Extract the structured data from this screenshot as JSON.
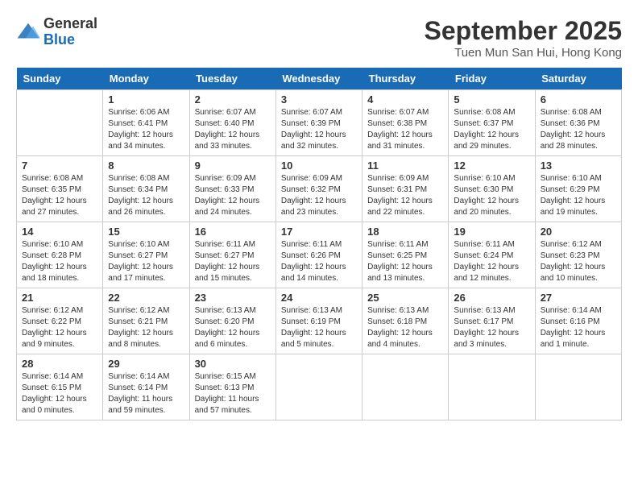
{
  "header": {
    "logo_general": "General",
    "logo_blue": "Blue",
    "month_title": "September 2025",
    "location": "Tuen Mun San Hui, Hong Kong"
  },
  "days_of_week": [
    "Sunday",
    "Monday",
    "Tuesday",
    "Wednesday",
    "Thursday",
    "Friday",
    "Saturday"
  ],
  "weeks": [
    [
      {
        "day": "",
        "detail": ""
      },
      {
        "day": "1",
        "detail": "Sunrise: 6:06 AM\nSunset: 6:41 PM\nDaylight: 12 hours\nand 34 minutes."
      },
      {
        "day": "2",
        "detail": "Sunrise: 6:07 AM\nSunset: 6:40 PM\nDaylight: 12 hours\nand 33 minutes."
      },
      {
        "day": "3",
        "detail": "Sunrise: 6:07 AM\nSunset: 6:39 PM\nDaylight: 12 hours\nand 32 minutes."
      },
      {
        "day": "4",
        "detail": "Sunrise: 6:07 AM\nSunset: 6:38 PM\nDaylight: 12 hours\nand 31 minutes."
      },
      {
        "day": "5",
        "detail": "Sunrise: 6:08 AM\nSunset: 6:37 PM\nDaylight: 12 hours\nand 29 minutes."
      },
      {
        "day": "6",
        "detail": "Sunrise: 6:08 AM\nSunset: 6:36 PM\nDaylight: 12 hours\nand 28 minutes."
      }
    ],
    [
      {
        "day": "7",
        "detail": "Sunrise: 6:08 AM\nSunset: 6:35 PM\nDaylight: 12 hours\nand 27 minutes."
      },
      {
        "day": "8",
        "detail": "Sunrise: 6:08 AM\nSunset: 6:34 PM\nDaylight: 12 hours\nand 26 minutes."
      },
      {
        "day": "9",
        "detail": "Sunrise: 6:09 AM\nSunset: 6:33 PM\nDaylight: 12 hours\nand 24 minutes."
      },
      {
        "day": "10",
        "detail": "Sunrise: 6:09 AM\nSunset: 6:32 PM\nDaylight: 12 hours\nand 23 minutes."
      },
      {
        "day": "11",
        "detail": "Sunrise: 6:09 AM\nSunset: 6:31 PM\nDaylight: 12 hours\nand 22 minutes."
      },
      {
        "day": "12",
        "detail": "Sunrise: 6:10 AM\nSunset: 6:30 PM\nDaylight: 12 hours\nand 20 minutes."
      },
      {
        "day": "13",
        "detail": "Sunrise: 6:10 AM\nSunset: 6:29 PM\nDaylight: 12 hours\nand 19 minutes."
      }
    ],
    [
      {
        "day": "14",
        "detail": "Sunrise: 6:10 AM\nSunset: 6:28 PM\nDaylight: 12 hours\nand 18 minutes."
      },
      {
        "day": "15",
        "detail": "Sunrise: 6:10 AM\nSunset: 6:27 PM\nDaylight: 12 hours\nand 17 minutes."
      },
      {
        "day": "16",
        "detail": "Sunrise: 6:11 AM\nSunset: 6:27 PM\nDaylight: 12 hours\nand 15 minutes."
      },
      {
        "day": "17",
        "detail": "Sunrise: 6:11 AM\nSunset: 6:26 PM\nDaylight: 12 hours\nand 14 minutes."
      },
      {
        "day": "18",
        "detail": "Sunrise: 6:11 AM\nSunset: 6:25 PM\nDaylight: 12 hours\nand 13 minutes."
      },
      {
        "day": "19",
        "detail": "Sunrise: 6:11 AM\nSunset: 6:24 PM\nDaylight: 12 hours\nand 12 minutes."
      },
      {
        "day": "20",
        "detail": "Sunrise: 6:12 AM\nSunset: 6:23 PM\nDaylight: 12 hours\nand 10 minutes."
      }
    ],
    [
      {
        "day": "21",
        "detail": "Sunrise: 6:12 AM\nSunset: 6:22 PM\nDaylight: 12 hours\nand 9 minutes."
      },
      {
        "day": "22",
        "detail": "Sunrise: 6:12 AM\nSunset: 6:21 PM\nDaylight: 12 hours\nand 8 minutes."
      },
      {
        "day": "23",
        "detail": "Sunrise: 6:13 AM\nSunset: 6:20 PM\nDaylight: 12 hours\nand 6 minutes."
      },
      {
        "day": "24",
        "detail": "Sunrise: 6:13 AM\nSunset: 6:19 PM\nDaylight: 12 hours\nand 5 minutes."
      },
      {
        "day": "25",
        "detail": "Sunrise: 6:13 AM\nSunset: 6:18 PM\nDaylight: 12 hours\nand 4 minutes."
      },
      {
        "day": "26",
        "detail": "Sunrise: 6:13 AM\nSunset: 6:17 PM\nDaylight: 12 hours\nand 3 minutes."
      },
      {
        "day": "27",
        "detail": "Sunrise: 6:14 AM\nSunset: 6:16 PM\nDaylight: 12 hours\nand 1 minute."
      }
    ],
    [
      {
        "day": "28",
        "detail": "Sunrise: 6:14 AM\nSunset: 6:15 PM\nDaylight: 12 hours\nand 0 minutes."
      },
      {
        "day": "29",
        "detail": "Sunrise: 6:14 AM\nSunset: 6:14 PM\nDaylight: 11 hours\nand 59 minutes."
      },
      {
        "day": "30",
        "detail": "Sunrise: 6:15 AM\nSunset: 6:13 PM\nDaylight: 11 hours\nand 57 minutes."
      },
      {
        "day": "",
        "detail": ""
      },
      {
        "day": "",
        "detail": ""
      },
      {
        "day": "",
        "detail": ""
      },
      {
        "day": "",
        "detail": ""
      }
    ]
  ]
}
